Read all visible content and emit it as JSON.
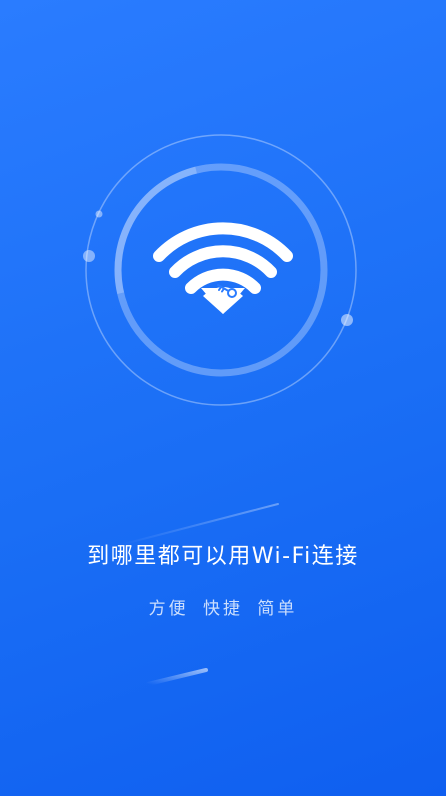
{
  "headline": "到哪里都可以用Wi-Fi连接",
  "subline": "方便 快捷 简单",
  "icon": "wifi-key-icon",
  "colors": {
    "background": "#1a6ef5",
    "text": "#ffffff"
  }
}
